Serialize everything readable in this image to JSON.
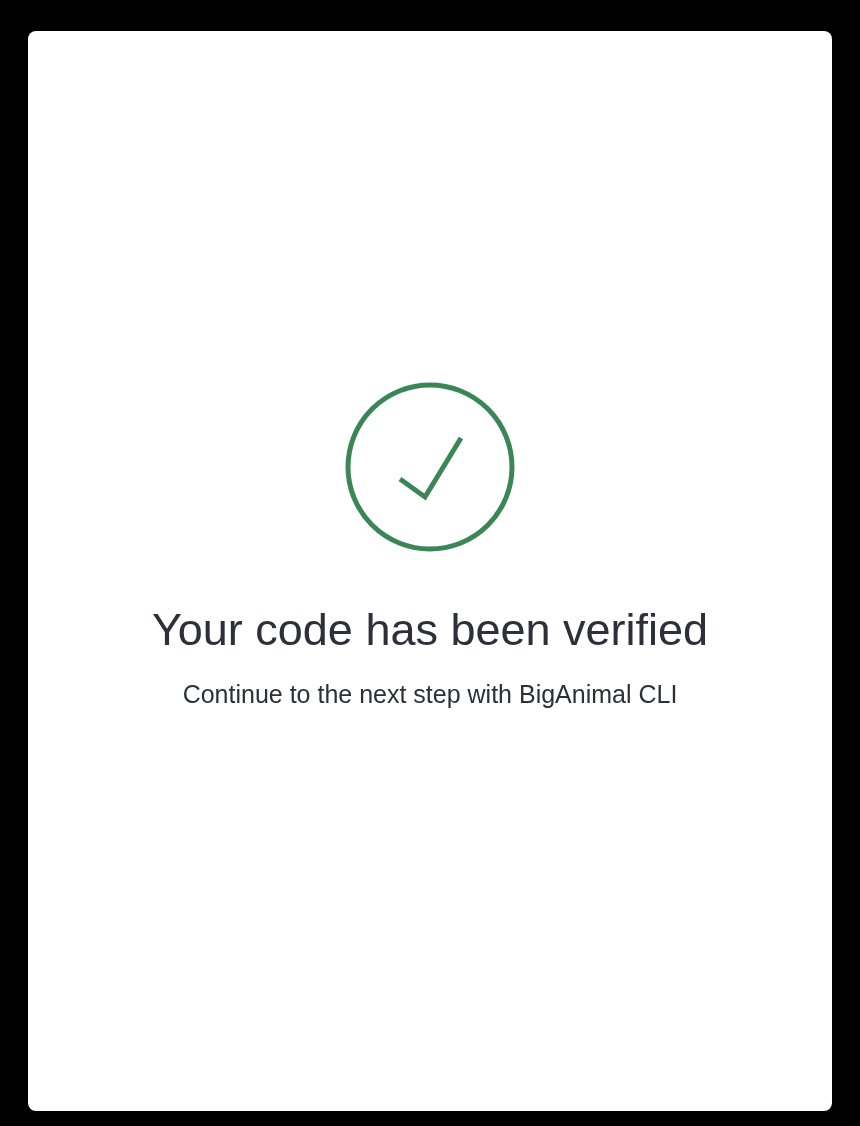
{
  "title": "Your code has been verified",
  "message": "Continue to the next step with BigAnimal CLI"
}
